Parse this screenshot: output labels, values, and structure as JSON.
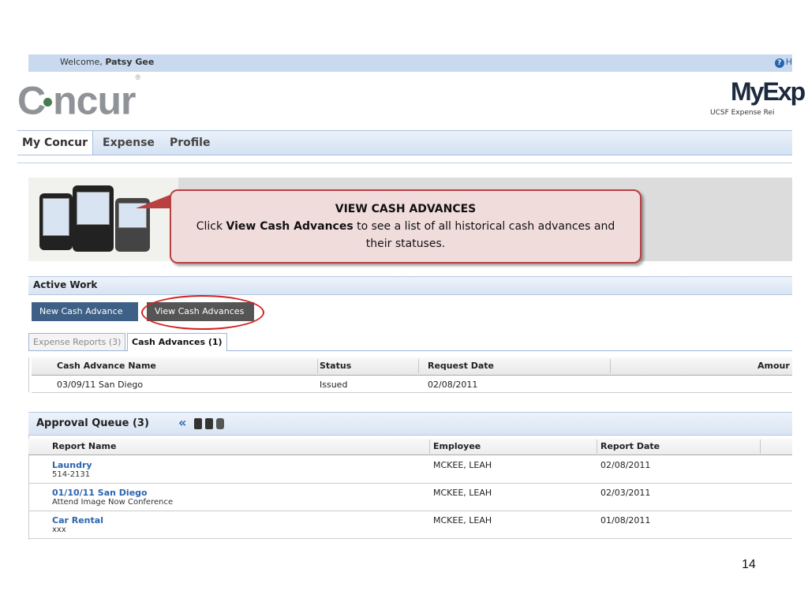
{
  "header": {
    "welcome_prefix": "Welcome,",
    "user_name": "Patsy Gee",
    "help_label": "H",
    "brand_logo": "Concur",
    "app_logo": "MyExp",
    "app_subtitle": "UCSF Expense Rei"
  },
  "nav": {
    "tabs": [
      {
        "label": "My Concur"
      },
      {
        "label": "Expense"
      },
      {
        "label": "Profile"
      }
    ]
  },
  "callout": {
    "title": "VIEW CASH ADVANCES",
    "text_before": "Click ",
    "text_bold": "View Cash Advances",
    "text_after": " to see a list of all historical cash advances and their statuses."
  },
  "active_work": {
    "title": "Active Work",
    "new_button": "New Cash Advance",
    "view_button": "View Cash Advances",
    "tabs": [
      {
        "label": "Expense Reports (3)"
      },
      {
        "label": "Cash Advances (1)"
      }
    ],
    "columns": [
      "Cash Advance Name",
      "Status",
      "Request Date",
      "Amour"
    ],
    "rows": [
      {
        "name": "03/09/11 San Diego",
        "status": "Issued",
        "date": "02/08/2011"
      }
    ]
  },
  "approval_queue": {
    "title": "Approval Queue (3)",
    "chevron": "«",
    "columns": [
      "Report Name",
      "Employee",
      "Report Date"
    ],
    "rows": [
      {
        "name": "Laundry",
        "sub": "514-2131",
        "employee": "MCKEE, LEAH",
        "date": "02/08/2011"
      },
      {
        "name": "01/10/11 San Diego",
        "sub": "Attend Image Now Conference",
        "employee": "MCKEE, LEAH",
        "date": "02/03/2011"
      },
      {
        "name": "Car Rental",
        "sub": "xxx",
        "employee": "MCKEE, LEAH",
        "date": "01/08/2011"
      }
    ]
  },
  "page_number": "14",
  "colors": {
    "nav_blue": "#d4e2f3",
    "button_blue": "#3e5f86",
    "highlight_red": "#d42020",
    "link_blue": "#2a64b0"
  }
}
